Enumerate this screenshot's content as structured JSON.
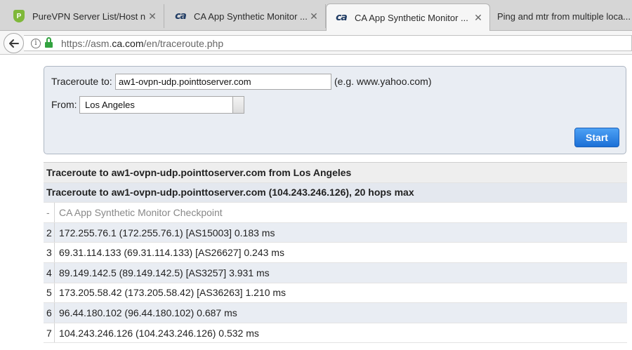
{
  "tabs": [
    {
      "title": "PureVPN Server List/Host n",
      "favicon": "purevpn-shield-icon",
      "active": false
    },
    {
      "title": "CA App Synthetic Monitor ...",
      "favicon": "ca-logo-icon",
      "active": false
    },
    {
      "title": "CA App Synthetic Monitor ...",
      "favicon": "ca-logo-icon",
      "active": true
    },
    {
      "title": "Ping and mtr from multiple loca...",
      "favicon": "",
      "active": false
    }
  ],
  "address": {
    "scheme": "https://asm.",
    "host": "ca.com",
    "path": "/en/traceroute.php"
  },
  "form": {
    "target_label": "Traceroute to:",
    "target_value": "aw1-ovpn-udp.pointtoserver.com",
    "hint": "(e.g. www.yahoo.com)",
    "from_label": "From:",
    "from_value": "Los Angeles",
    "start_label": "Start"
  },
  "results": {
    "heading": "Traceroute to aw1-ovpn-udp.pointtoserver.com from Los Angeles",
    "subheading": "Traceroute to aw1-ovpn-udp.pointtoserver.com (104.243.246.126), 20 hops max",
    "hops": [
      {
        "num": "-",
        "text": "CA App Synthetic Monitor Checkpoint"
      },
      {
        "num": "2",
        "text": "172.255.76.1 (172.255.76.1) [AS15003] 0.183 ms"
      },
      {
        "num": "3",
        "text": "69.31.114.133 (69.31.114.133) [AS26627] 0.243 ms"
      },
      {
        "num": "4",
        "text": "89.149.142.5 (89.149.142.5) [AS3257] 3.931 ms"
      },
      {
        "num": "5",
        "text": "173.205.58.42 (173.205.58.42) [AS36263] 1.210 ms"
      },
      {
        "num": "6",
        "text": "96.44.180.102 (96.44.180.102) 0.687 ms"
      },
      {
        "num": "7",
        "text": "104.243.246.126 (104.243.246.126) 0.532 ms"
      }
    ]
  },
  "colors": {
    "accent": "#1b6fd6",
    "panel": "#e9edf3",
    "lock": "#33a340"
  }
}
